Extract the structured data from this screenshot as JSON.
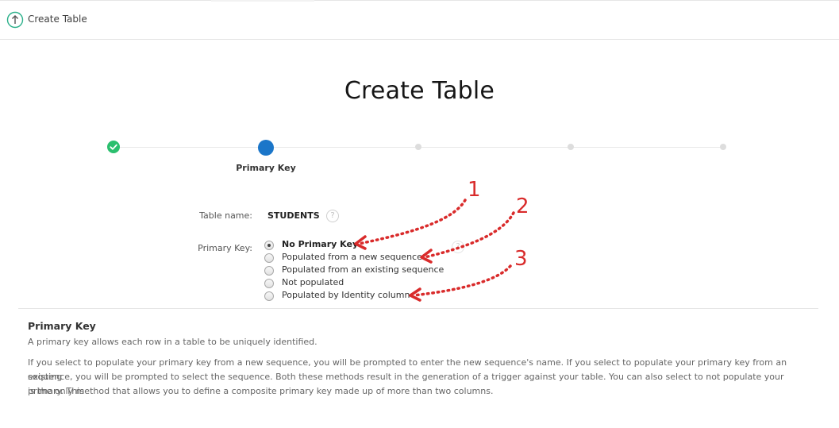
{
  "header": {
    "app_title": "Create Table",
    "app_icon": "arrow-up-circle-icon"
  },
  "page": {
    "title": "Create Table"
  },
  "wizard": {
    "current_step_label": "Primary Key",
    "steps": [
      {
        "state": "done",
        "icon": "check-icon"
      },
      {
        "state": "current"
      },
      {
        "state": "pending"
      },
      {
        "state": "pending"
      },
      {
        "state": "pending"
      }
    ]
  },
  "form": {
    "table_name_label": "Table name:",
    "table_name_value": "STUDENTS",
    "primary_key_label": "Primary Key:",
    "help_icon_glyph": "?",
    "primary_key_options": [
      {
        "label": "No Primary Key",
        "checked": true
      },
      {
        "label": "Populated from a new sequence",
        "checked": false
      },
      {
        "label": "Populated from an existing sequence",
        "checked": false
      },
      {
        "label": "Not populated",
        "checked": false
      },
      {
        "label": "Populated by Identity column",
        "checked": false
      }
    ]
  },
  "annotations": {
    "color": "#d92b2b",
    "labels": [
      "1",
      "2",
      "3"
    ]
  },
  "help": {
    "title": "Primary Key",
    "summary": "A primary key allows each row in a table to be uniquely identified.",
    "line1": "If you select to populate your primary key from a new sequence, you will be prompted to enter the new sequence's name. If you select to populate your primary key from an existing",
    "line2": "sequence, you will be prompted to select the sequence. Both these methods result in the generation of a trigger against your table. You can also select to not populate your primary. This",
    "line3": "is the only method that allows you to define a composite primary key made up of more than two columns."
  },
  "colors": {
    "accent": "#1b76c9",
    "success": "#2bbf6e",
    "pending": "#dddddd"
  }
}
